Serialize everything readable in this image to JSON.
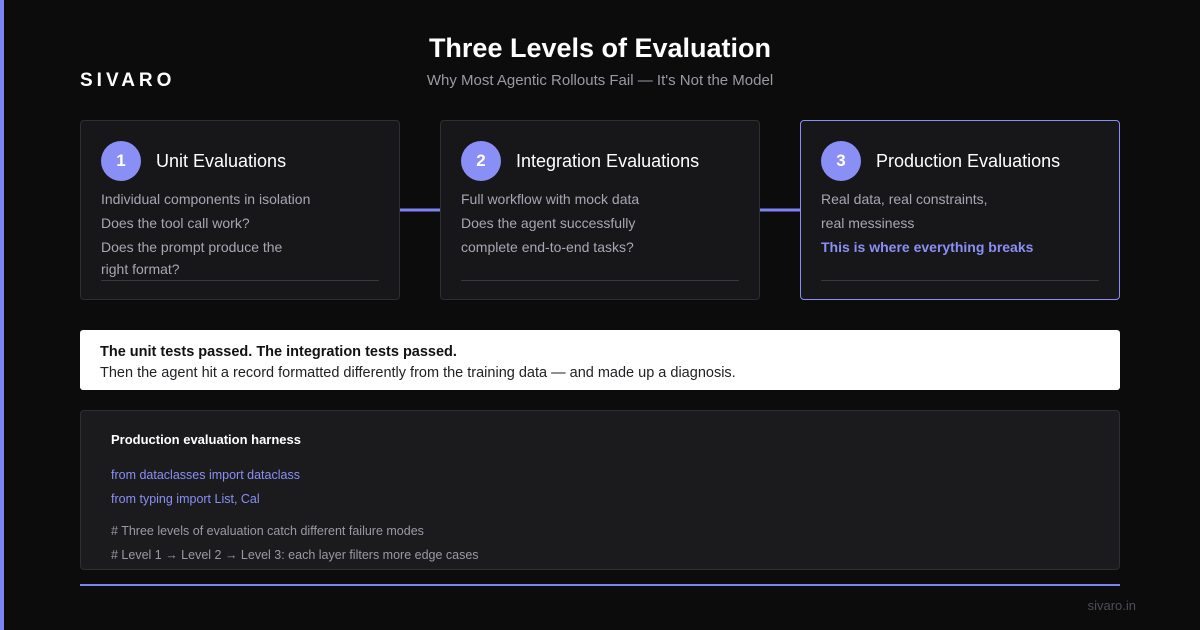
{
  "brand": "SIVARO",
  "header": {
    "title": "Three Levels of Evaluation",
    "subtitle": "Why Most Agentic Rollouts Fail — It's Not the Model"
  },
  "levels": [
    {
      "number": "1",
      "title": "Unit Evaluations",
      "lines": [
        "Individual components in isolation",
        "Does the tool call work?",
        "Does the prompt produce the",
        "right format?"
      ]
    },
    {
      "number": "2",
      "title": "Integration Evaluations",
      "lines": [
        "Full workflow with mock data",
        "Does the agent successfully",
        "complete end-to-end tasks?"
      ]
    },
    {
      "number": "3",
      "title": "Production Evaluations",
      "lines": [
        "Real data, real constraints,",
        "real messiness"
      ],
      "highlight": "This is where everything breaks"
    }
  ],
  "callout": {
    "strong": "The unit tests passed. The integration tests passed.",
    "text": "Then the agent hit a record formatted differently from the training data — and made up a diagnosis."
  },
  "code": {
    "title": "Production evaluation harness",
    "imports": [
      "from dataclasses import dataclass",
      "from typing import List, Cal"
    ],
    "comments": [
      "# Three levels of evaluation catch different failure modes",
      "# Level 1 → Level 2 → Level 3: each layer filters more edge cases"
    ]
  },
  "footer": "sivaro.in",
  "colors": {
    "accent": "#8a8ff5",
    "background": "#0c0c0d",
    "card": "#17171a"
  }
}
